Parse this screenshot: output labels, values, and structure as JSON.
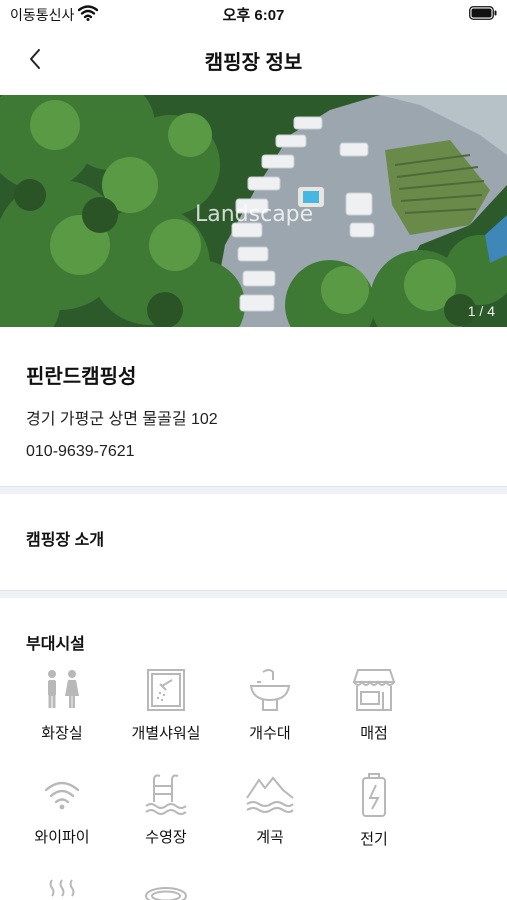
{
  "status_bar": {
    "carrier": "이동통신사",
    "time": "오후 6:07",
    "icons": [
      "wifi-icon",
      "battery-icon"
    ]
  },
  "nav": {
    "title": "캠핑장 정보",
    "back_icon": "chevron-left-icon"
  },
  "hero": {
    "watermark": "Landscape",
    "counter": "1 / 4",
    "current_index": 1,
    "total": 4
  },
  "camp": {
    "name": "핀란드캠핑성",
    "address": "경기 가평군 상면 물골길 102",
    "phone": "010-9639-7621"
  },
  "sections": {
    "intro_title": "캠핑장 소개",
    "facilities_title": "부대시설"
  },
  "amenities": [
    {
      "label": "화장실",
      "icon": "restroom-icon"
    },
    {
      "label": "개별샤워실",
      "icon": "shower-icon"
    },
    {
      "label": "개수대",
      "icon": "sink-icon"
    },
    {
      "label": "매점",
      "icon": "store-icon"
    },
    {
      "label": "와이파이",
      "icon": "wifi-icon"
    },
    {
      "label": "수영장",
      "icon": "pool-icon"
    },
    {
      "label": "계곡",
      "icon": "valley-icon"
    },
    {
      "label": "전기",
      "icon": "electricity-icon"
    },
    {
      "icon": "hot-spring-icon"
    },
    {
      "icon": "trampoline-icon"
    }
  ],
  "colors": {
    "text": "#111111",
    "icon_gray": "#b8b8b8",
    "divider": "#eef1f5"
  }
}
